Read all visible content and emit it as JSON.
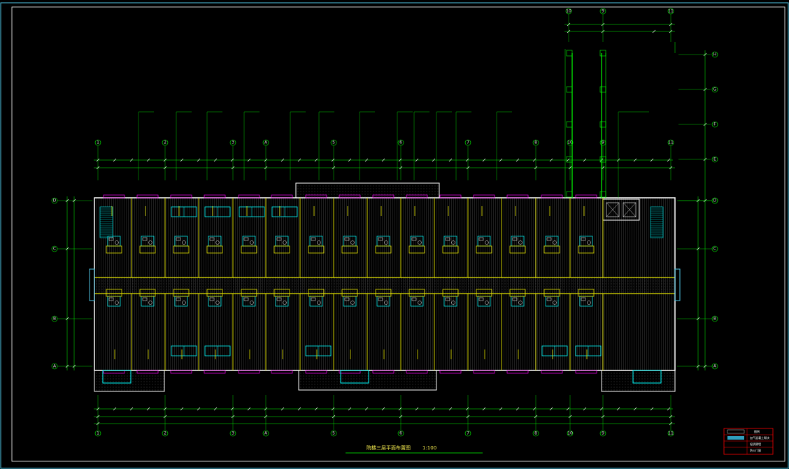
{
  "drawing": {
    "title": "院楼三层平面布置图",
    "scale": "1:100",
    "background": "#000000",
    "colors": {
      "wall": "#e6e600",
      "partition": "#ffffff",
      "axis": "#00ff00",
      "dimension": "#00ffff",
      "fixture": "#00ffff",
      "window": "#ff00ff",
      "frame": "#4fc8e8",
      "floor_hatch": "#3c3c3c",
      "title_box": "#ff0000"
    }
  },
  "grid": {
    "columns": [
      "1",
      "2",
      "3",
      "4",
      "5",
      "6",
      "7",
      "8",
      "9",
      "10",
      "11"
    ],
    "column_labels_display": [
      "1",
      "2",
      "3",
      "A",
      "5",
      "6",
      "7",
      "8",
      "10",
      "9",
      "11"
    ],
    "rows": [
      "A",
      "B",
      "C",
      "D"
    ],
    "upper_rows": [
      "D",
      "E",
      "F",
      "G",
      "H"
    ],
    "top_tower_columns": [
      "10",
      "9",
      "11"
    ]
  },
  "legend": {
    "title": "图例",
    "items": [
      {
        "symbol": "墙",
        "label": "加气混凝土砌块"
      },
      {
        "symbol": "板",
        "label": "轻质隔墙"
      },
      {
        "symbol": "门",
        "label": "防火门窗"
      }
    ]
  }
}
